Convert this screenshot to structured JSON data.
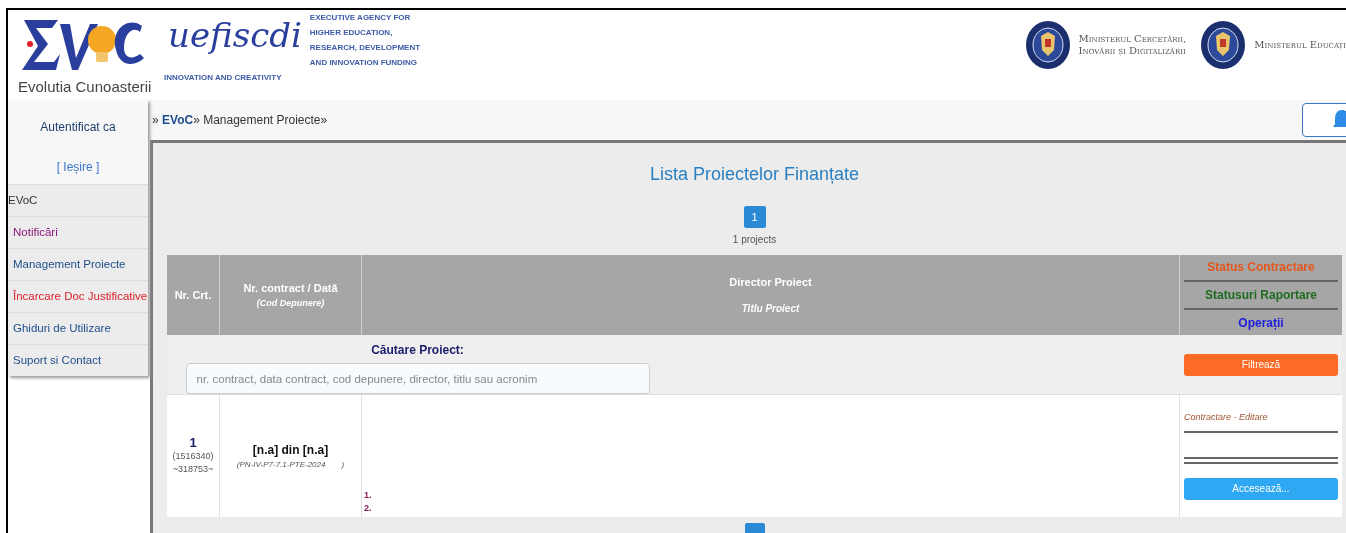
{
  "header": {
    "evoc_caption": "Evolutia Cunoasterii",
    "uefiscdi_wordmark": "uefiscdi",
    "uefiscdi_tagline": "INNOVATION AND CREATIVITY",
    "agency_lines": [
      "EXECUTIVE AGENCY FOR",
      "HIGHER EDUCATION,",
      "RESEARCH, DEVELOPMENT",
      "AND INNOVATION FUNDING"
    ],
    "ministries": [
      {
        "lines": [
          "Ministerul Cercetării,",
          "Inovării și Digitalizării"
        ]
      },
      {
        "lines": [
          "Ministerul Educați"
        ]
      }
    ]
  },
  "breadcrumb": {
    "prefix": "» ",
    "link": "EVoC",
    "rest": "» Management Proiecte»"
  },
  "sidebar": {
    "auth_label": "Autentificat ca",
    "logout": "[ Ieșire ]",
    "items": [
      {
        "label": "EVoC",
        "color": "#333333"
      },
      {
        "label": "Notificări",
        "color": "#8b1a7a"
      },
      {
        "label": "Management Proiecte",
        "color": "#1f4e8c"
      },
      {
        "label": "Încarcare Doc Justificative",
        "color": "#e0202a"
      },
      {
        "label": "Ghiduri de Utilizare",
        "color": "#1f4e8c"
      },
      {
        "label": "Suport si Contact",
        "color": "#1f4e8c"
      }
    ]
  },
  "main": {
    "title": "Lista Proiectelor Finanțate",
    "pages": [
      {
        "label": "1",
        "selected": true
      }
    ],
    "count": "1 projects",
    "table": {
      "columns": [
        {
          "title": "Nr. Crt."
        },
        {
          "title": "Nr. contract / Dată",
          "subtitle": "(Cod Depunere)"
        },
        {
          "title": "Director Proiect",
          "subtitle": "Titlu Proiect"
        },
        {
          "status_lines": [
            {
              "label": "Status Contractare",
              "color": "#e4561c"
            },
            {
              "label": "Statusuri Raportare",
              "color": "#1f6b1f"
            },
            {
              "label": "Operații",
              "color": "#1d1de0"
            }
          ]
        }
      ],
      "search": {
        "label": "Căutare Proiect:",
        "placeholder": "nr. contract, data contract, cod depunere, director, titlu sau acronim",
        "button": "Filtrează"
      },
      "rows": [
        {
          "index": "1",
          "id": "(1516340)",
          "code": "~318753~",
          "contract": "[n.a] din [n.a]",
          "submission": "(PN-IV-P7-7.1-PTE-2024",
          "submission_end": ")",
          "list_marks": [
            "1.",
            "2."
          ],
          "status_link": "Contractare - Editare",
          "action": "Accesează..."
        }
      ]
    }
  }
}
